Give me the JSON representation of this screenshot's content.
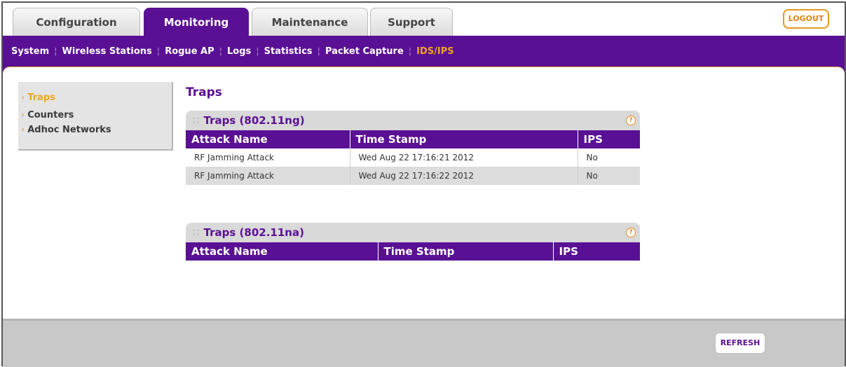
{
  "tabs": [
    {
      "label": "Configuration"
    },
    {
      "label": "Monitoring"
    },
    {
      "label": "Maintenance"
    },
    {
      "label": "Support"
    }
  ],
  "logout_label": "LOGOUT",
  "subnav": [
    {
      "label": "System"
    },
    {
      "label": "Wireless Stations"
    },
    {
      "label": "Rogue AP"
    },
    {
      "label": "Logs"
    },
    {
      "label": "Statistics"
    },
    {
      "label": "Packet Capture"
    },
    {
      "label": "IDS/IPS"
    }
  ],
  "sidebar": [
    {
      "label": "Traps"
    },
    {
      "label": "Counters"
    },
    {
      "label": "Adhoc Networks"
    }
  ],
  "page_title": "Traps",
  "panel_ng": {
    "title": "Traps (802.11ng)",
    "columns": [
      "Attack Name",
      "Time Stamp",
      "IPS"
    ],
    "rows": [
      [
        "RF Jamming Attack",
        "Wed Aug 22 17:16:21 2012",
        "No"
      ],
      [
        "RF Jamming Attack",
        "Wed Aug 22 17:16:22 2012",
        "No"
      ]
    ]
  },
  "panel_na": {
    "title": "Traps (802.11na)",
    "columns": [
      "Attack Name",
      "Time Stamp",
      "IPS"
    ]
  },
  "help_glyph": "?",
  "refresh_label": "REFRESH"
}
